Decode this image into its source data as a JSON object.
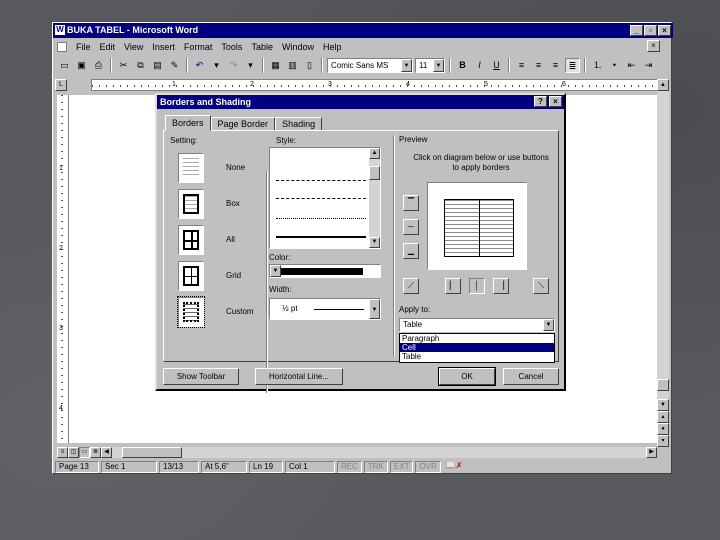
{
  "window": {
    "title": "BUKA TABEL - Microsoft Word",
    "controls": [
      "_",
      "▫",
      "×"
    ]
  },
  "menu": {
    "items": [
      "File",
      "Edit",
      "View",
      "Insert",
      "Format",
      "Tools",
      "Table",
      "Window",
      "Help"
    ],
    "close": "×"
  },
  "toolbar": {
    "font_name": "Comic Sans MS",
    "font_size": "11"
  },
  "ruler": {
    "numbers": [
      "1",
      "2",
      "3",
      "4",
      "5",
      "6"
    ],
    "v_numbers": [
      "1",
      "2",
      "3",
      "4"
    ]
  },
  "status": {
    "page": "Page 13",
    "sec": "Sec 1",
    "pages": "13/13",
    "at": "At 5,6\"",
    "ln": "Ln 19",
    "col": "Col 1",
    "rec": "REC",
    "trk": "TRK",
    "ext": "EXT",
    "ovr": "OVR"
  },
  "dialog": {
    "title": "Borders and Shading",
    "help": "?",
    "close": "×",
    "tabs": [
      "Borders",
      "Page Border",
      "Shading"
    ],
    "setting_label": "Setting:",
    "settings": [
      "None",
      "Box",
      "All",
      "Grid",
      "Custom"
    ],
    "style_label": "Style:",
    "color_label": "Color:",
    "width_label": "Width:",
    "width_value": "½ pt",
    "preview_label": "Preview",
    "preview_text": "Click on diagram below or use buttons to apply borders",
    "apply_label": "Apply to:",
    "apply_value": "Table",
    "apply_options": [
      "Paragraph",
      "Cell",
      "Table"
    ],
    "apply_selected_index": 1,
    "buttons": {
      "show_toolbar": "Show Toolbar",
      "horizontal_line": "Horizontal Line...",
      "ok": "OK",
      "cancel": "Cancel"
    }
  }
}
